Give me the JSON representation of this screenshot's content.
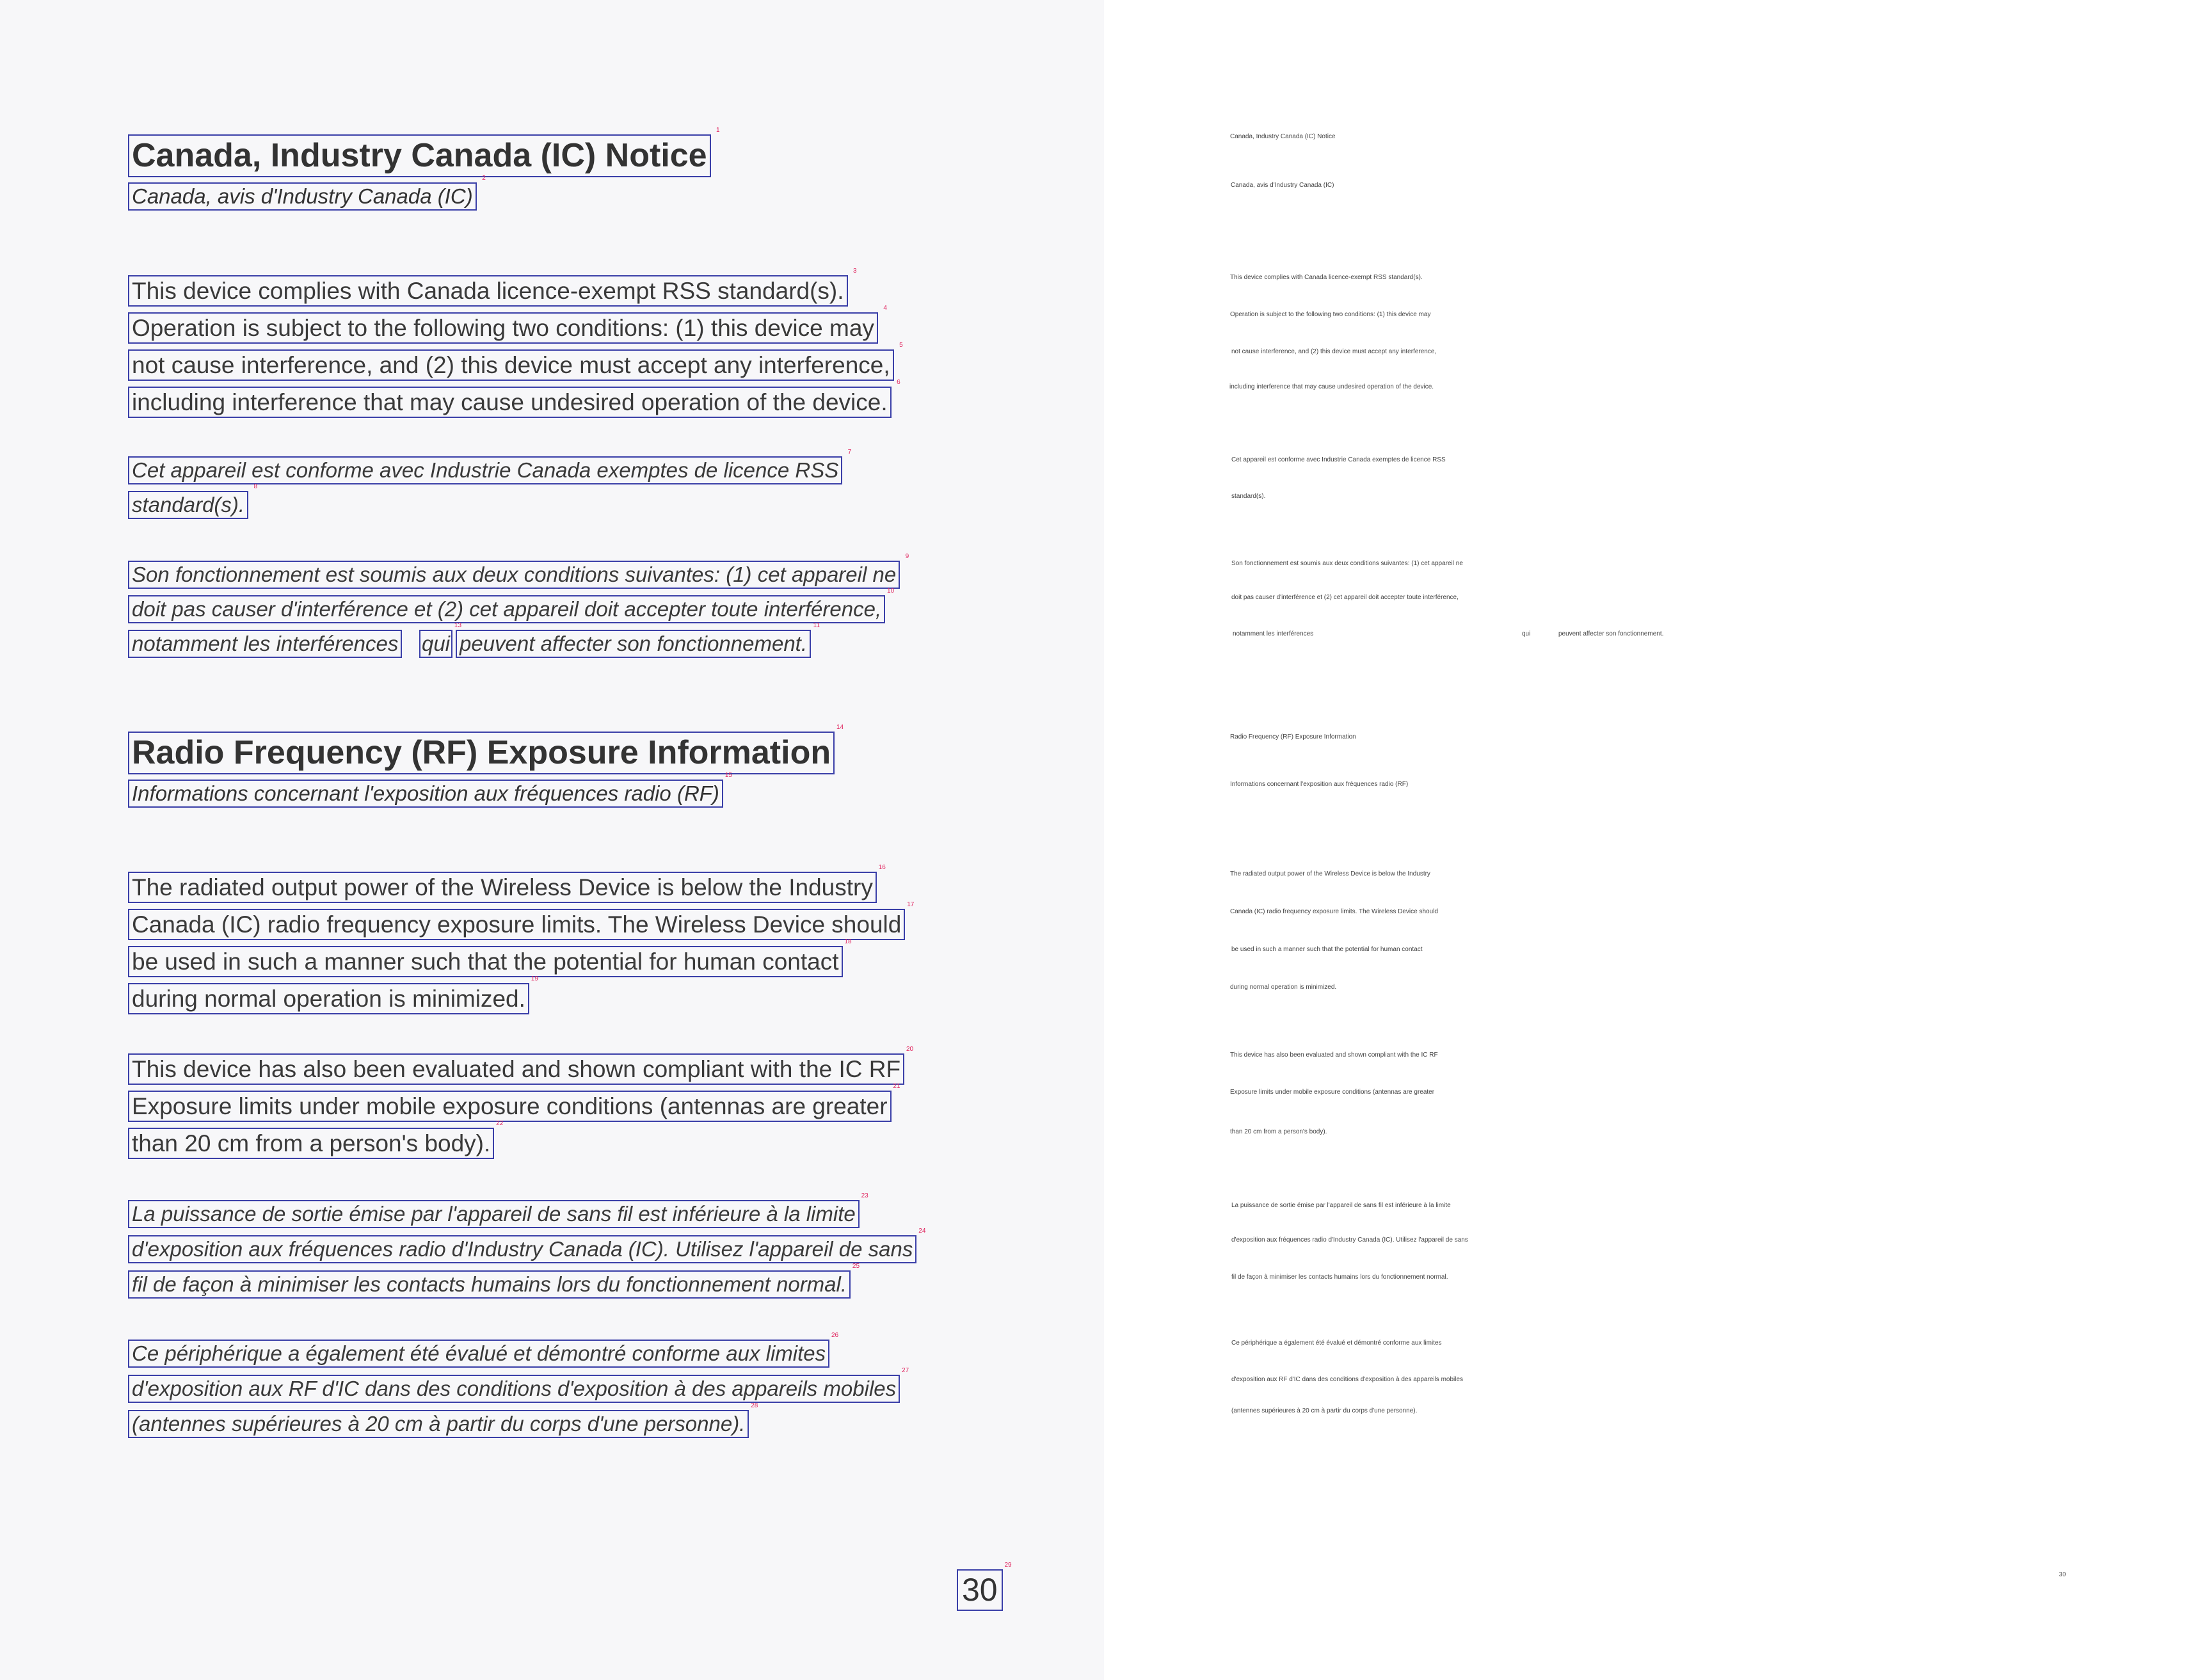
{
  "left": {
    "heading1": "Canada, Industry Canada (IC) Notice",
    "heading1_fr": "Canada, avis d'Industry Canada (IC)",
    "para1": [
      "This device complies with Canada licence-exempt RSS standard(s).",
      "Operation is subject to the following two conditions: (1) this device may",
      "not cause interference, and (2) this device must accept any interference,",
      "including interference that may cause undesired operation of the device."
    ],
    "para1_fr": [
      "Cet appareil est conforme avec Industrie Canada exemptes de licence RSS",
      "standard(s)."
    ],
    "para2_fr_lines": [
      "Son fonctionnement est soumis aux deux conditions suivantes: (1) cet appareil ne",
      "doit pas causer d'interférence et (2) cet appareil doit accepter toute interférence,"
    ],
    "para2_fr_last": {
      "a": "notamment les interférences",
      "b": "qui",
      "c": "peuvent affecter son fonctionnement."
    },
    "heading2": "Radio Frequency (RF) Exposure Information",
    "heading2_fr": "Informations concernant l'exposition aux fréquences radio (RF)",
    "para3": [
      "The radiated output power of the Wireless Device is below the Industry",
      "Canada (IC) radio frequency exposure limits. The Wireless Device should",
      "be used in such a manner such that the potential for human contact",
      "during normal operation is minimized."
    ],
    "para4": [
      "This device has also been evaluated and shown compliant with the IC RF",
      "Exposure limits under mobile exposure conditions (antennas are greater",
      "than 20 cm from a person's body)."
    ],
    "para3_fr": [
      "La puissance de sortie émise par l'appareil de sans fil est inférieure à la limite",
      "d'exposition aux fréquences radio d'Industry Canada (IC). Utilisez l'appareil de sans",
      "fil de façon à minimiser les contacts humains lors du fonctionnement normal."
    ],
    "para4_fr": [
      "Ce périphérique a également été évalué et démontré conforme aux limites",
      "d'exposition aux RF d'IC dans des conditions d'exposition à des appareils mobiles",
      "(antennes supérieures à 20 cm à partir du corps d'une personne)."
    ],
    "page_number": "30"
  },
  "tags": [
    "1",
    "2",
    "3",
    "4",
    "5",
    "6",
    "7",
    "8",
    "9",
    "10",
    "11",
    "12",
    "13",
    "14",
    "15",
    "16",
    "17",
    "18",
    "19",
    "20",
    "21",
    "22",
    "23",
    "24",
    "25",
    "26",
    "27",
    "28",
    "29"
  ],
  "right": {
    "lines": [
      "Canada, Industry Canada (IC) Notice",
      "Canada, avis d'Industry Canada (IC)",
      "This device complies with Canada licence-exempt RSS standard(s).",
      "Operation is subject to the following two conditions: (1) this device may",
      "not cause interference, and (2) this device must accept any interference,",
      "including interference that may cause undesired operation of the device.",
      "Cet appareil est conforme avec Industrie Canada exemptes de licence RSS",
      "standard(s).",
      "Son fonctionnement est soumis aux deux conditions suivantes: (1) cet appareil ne",
      "doit pas causer d'interférence et (2) cet appareil doit accepter toute interférence,",
      "notamment les interférences",
      "qui",
      "peuvent affecter son fonctionnement.",
      "Radio Frequency (RF) Exposure Information",
      "Informations concernant l'exposition aux fréquences radio (RF)",
      "The radiated output power of the Wireless Device is below the Industry",
      "Canada (IC) radio frequency exposure limits. The Wireless Device should",
      "be used in such a manner such that the potential for human contact",
      "during normal operation is minimized.",
      "This device has also been evaluated and shown compliant with the IC RF",
      "Exposure limits under mobile exposure conditions (antennas are greater",
      "than 20 cm from a person's body).",
      "La puissance de sortie émise par l'appareil de sans fil est inférieure à la limite",
      "d'exposition aux fréquences radio d'Industry Canada (IC). Utilisez l'appareil de sans",
      "fil de façon à minimiser les contacts humains lors du fonctionnement normal.",
      "Ce périphérique a également été évalué et démontré conforme aux limites",
      "d'exposition aux RF d'IC dans des conditions d'exposition à des appareils mobiles",
      "(antennes supérieures à 20 cm à partir du corps d'une personne).",
      "30"
    ]
  }
}
